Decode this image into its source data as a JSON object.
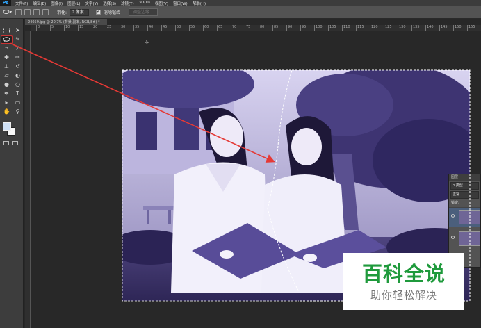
{
  "app": {
    "logo": "Ps"
  },
  "menu": [
    "文件(F)",
    "编辑(E)",
    "图像(I)",
    "图层(L)",
    "文字(Y)",
    "选择(S)",
    "滤镜(T)",
    "3D(D)",
    "视图(V)",
    "窗口(W)",
    "帮助(H)"
  ],
  "options": {
    "feather_label": "羽化:",
    "feather_value": "0 像素",
    "antialias_label": "消除锯齿",
    "refine_edge_label": "调整边缘..."
  },
  "document": {
    "tab_title": "24059.jpg @ 20.7% (背景 副本, RGB/8#) *"
  },
  "rulers": {
    "h_ticks": [
      "0",
      "5",
      "10",
      "15",
      "20",
      "25",
      "30",
      "35",
      "40",
      "45",
      "50",
      "55",
      "60",
      "65",
      "70",
      "75",
      "80",
      "85",
      "90",
      "95",
      "100",
      "105",
      "110",
      "115",
      "120",
      "125",
      "130",
      "135",
      "140",
      "145",
      "150",
      "155",
      "160",
      "165",
      "170",
      "175"
    ]
  },
  "layers_panel": {
    "title": "图层",
    "filter_label": "ρ 类型",
    "blend_mode": "正常",
    "lock_label": "锁定:"
  },
  "tools": [
    "move-icon",
    "marquee-icon",
    "lasso-icon",
    "quick-select-icon",
    "crop-icon",
    "eyedropper-icon",
    "healing-icon",
    "brush-icon",
    "stamp-icon",
    "history-brush-icon",
    "eraser-icon",
    "gradient-icon",
    "blur-icon",
    "dodge-icon",
    "pen-icon",
    "type-icon",
    "path-select-icon",
    "shape-icon",
    "hand-icon",
    "zoom-icon"
  ],
  "colors": {
    "foreground": "#cfe0f5",
    "background": "#f7f7f7",
    "annotation_arrow": "#e53935",
    "photo_tint": "#6f6596"
  },
  "watermark": {
    "title": "百科全说",
    "subtitle": "助你轻松解决"
  }
}
